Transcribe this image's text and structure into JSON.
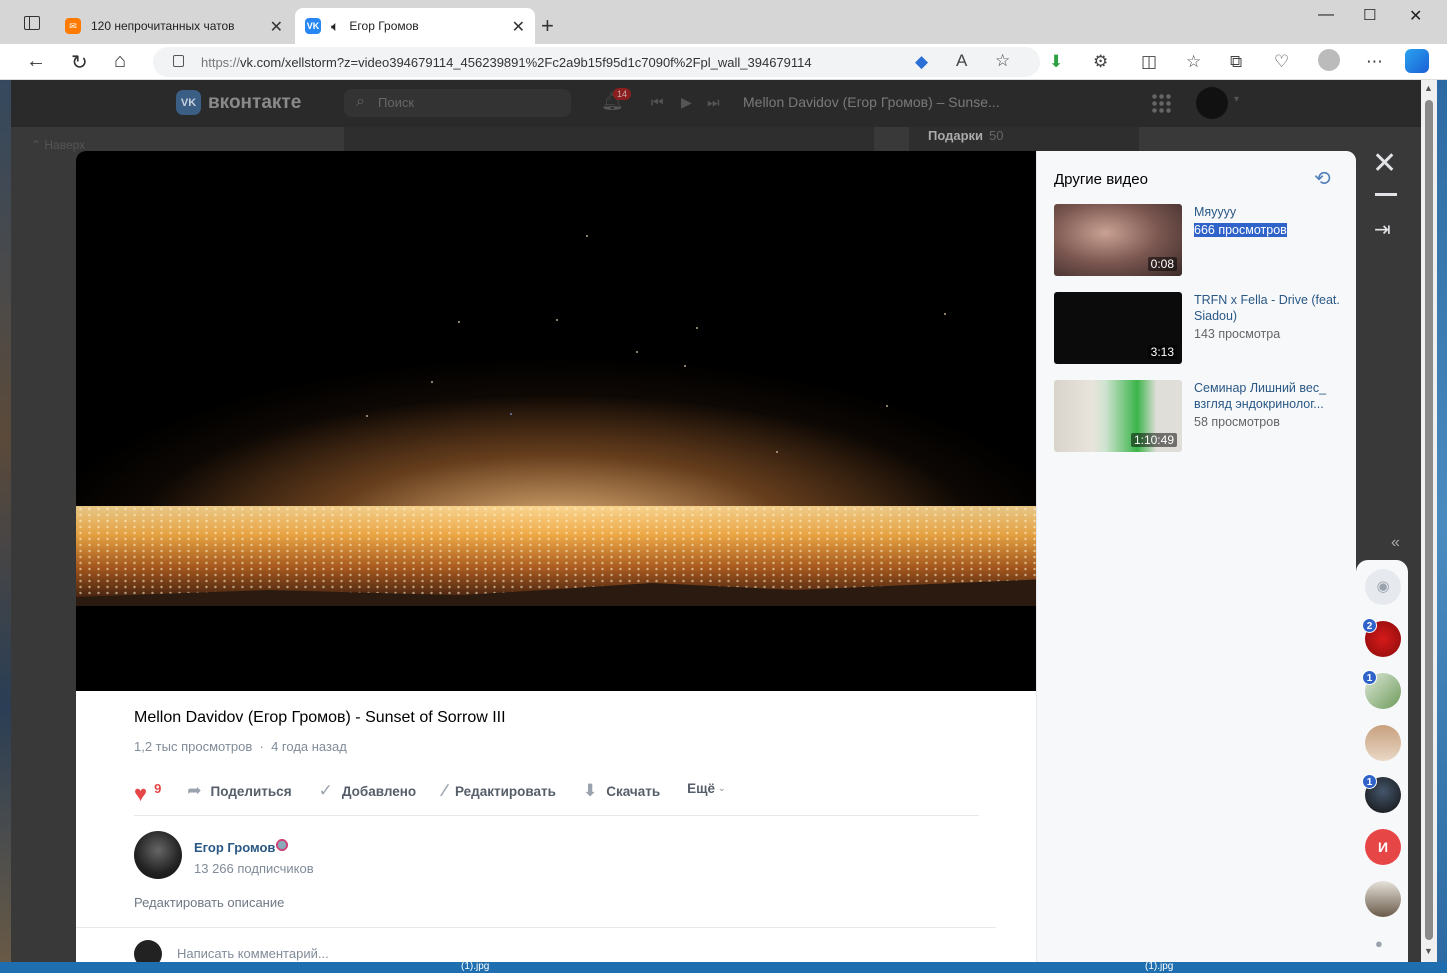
{
  "browser": {
    "tabs": [
      {
        "label": "120 непрочитанных чатов",
        "favicon": "mail-icon",
        "color": "#ff7a00"
      },
      {
        "label": "Егор Громов",
        "favicon": "vk-icon",
        "color": "#2787f5",
        "active": true
      }
    ],
    "url_prefix": "https://",
    "url_rest": "vk.com/xellstorm?z=video394679114_456239891%2Fc2a9b15f95d1c7090f%2Fpl_wall_394679114"
  },
  "vk_header": {
    "logo_text": "вконтакте",
    "search_placeholder": "Поиск",
    "notifications_count": "14",
    "now_playing": "Mellon Davidov (Егор Громов) – Sunse..."
  },
  "background": {
    "back_to_top": "Наверх",
    "gifts_label": "Подарки",
    "gifts_count": "50"
  },
  "video": {
    "title": "Mellon Davidov (Егор Громов) - Sunset of Sorrow III",
    "views": "1,2 тыс просмотров",
    "age": "4 года назад",
    "likes": "9",
    "actions": {
      "share": "Поделиться",
      "added": "Добавлено",
      "edit": "Редактировать",
      "download": "Скачать",
      "more": "Ещё"
    },
    "owner": {
      "name": "Егор Громов",
      "subscribers": "13 266 подписчиков"
    },
    "edit_description": "Редактировать описание",
    "comment_placeholder": "Написать комментарий..."
  },
  "sidebar": {
    "title": "Другие видео",
    "videos": [
      {
        "title": "Мяуууу",
        "views": "666 просмотров",
        "duration": "0:08"
      },
      {
        "title": "TRFN x Fella - Drive (feat. Siadou)",
        "views": "143 просмотра",
        "duration": "3:13"
      },
      {
        "title": "Семинар Лишний вес_ взгляд эндокринолог...",
        "views": "58 просмотров",
        "duration": "1:10:49"
      }
    ]
  },
  "chats": [
    {
      "name": "camera-chat",
      "badge": ""
    },
    {
      "name": "chat-rose",
      "badge": "2"
    },
    {
      "name": "chat-flower",
      "badge": "1"
    },
    {
      "name": "chat-girl",
      "badge": ""
    },
    {
      "name": "chat-dark",
      "badge": "1"
    },
    {
      "name": "chat-letter",
      "badge": "",
      "letter": "И"
    },
    {
      "name": "chat-man",
      "badge": ""
    }
  ],
  "desktop": {
    "file1": "(1).jpg",
    "file2": "(1).jpg"
  }
}
